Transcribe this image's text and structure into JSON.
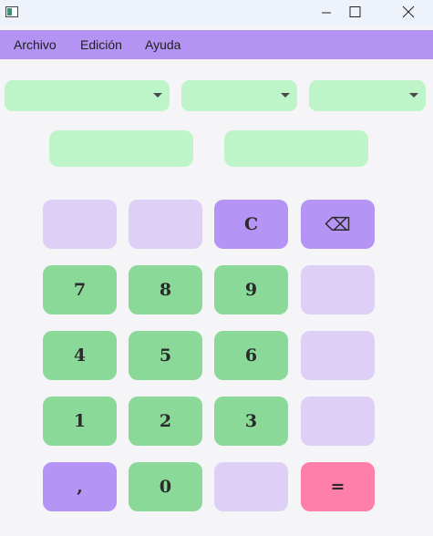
{
  "window": {
    "controls": {
      "minimize_icon": "minimize-icon",
      "maximize_icon": "maximize-icon",
      "close_icon": "close-icon"
    }
  },
  "menu": {
    "archivo": "Archivo",
    "edicion": "Edición",
    "ayuda": "Ayuda"
  },
  "selectors": [
    {
      "value": ""
    },
    {
      "value": ""
    },
    {
      "value": ""
    }
  ],
  "fields": [
    {
      "value": ""
    },
    {
      "value": ""
    }
  ],
  "keypad": {
    "clear": "C",
    "backspace": "⌫",
    "seven": "7",
    "eight": "8",
    "nine": "9",
    "four": "4",
    "five": "5",
    "six": "6",
    "one": "1",
    "two": "2",
    "three": "3",
    "comma": ",",
    "zero": "0",
    "equals": "="
  },
  "colors": {
    "menubar": "#b394f3",
    "input_green": "#bdf5c8",
    "digit_green": "#8ad999",
    "lavender": "#decff6",
    "purple": "#b494f5",
    "equals_pink": "#ff7fab"
  }
}
